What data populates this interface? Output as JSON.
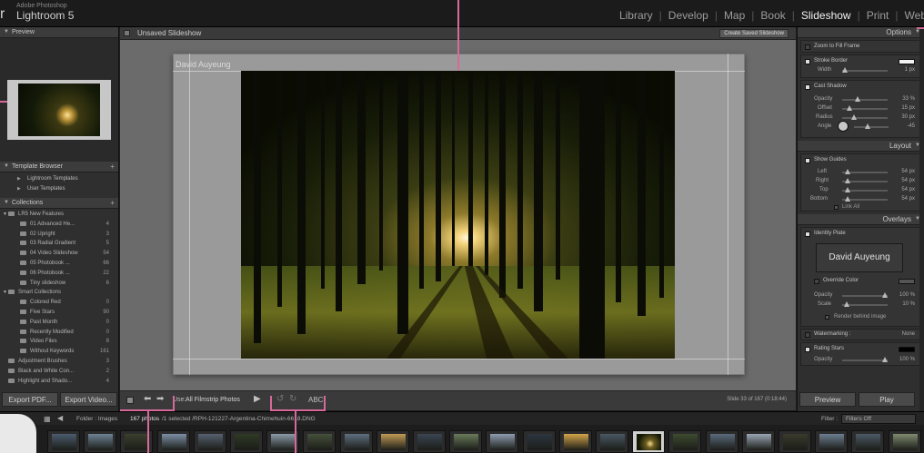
{
  "app": {
    "brand_small": "Adobe Photoshop",
    "brand": "Lightroom 5",
    "edge_letter": "r"
  },
  "modules": [
    {
      "label": "Library",
      "active": false
    },
    {
      "label": "Develop",
      "active": false
    },
    {
      "label": "Map",
      "active": false
    },
    {
      "label": "Book",
      "active": false
    },
    {
      "label": "Slideshow",
      "active": true
    },
    {
      "label": "Print",
      "active": false
    },
    {
      "label": "Web",
      "active": false
    }
  ],
  "left": {
    "preview_title": "Preview",
    "template_title": "Template Browser",
    "templates": [
      "Lightroom Templates",
      "User Templates"
    ],
    "collections_title": "Collections",
    "collections": [
      {
        "label": "LR5 New Features",
        "count": "",
        "indent": 1,
        "group": true
      },
      {
        "label": "01 Advanced He...",
        "count": "4",
        "indent": 2
      },
      {
        "label": "02 Upright",
        "count": "3",
        "indent": 2
      },
      {
        "label": "03 Radial Gradient",
        "count": "5",
        "indent": 2
      },
      {
        "label": "04 Video Slideshow",
        "count": "54",
        "indent": 2
      },
      {
        "label": "05 Photobook ...",
        "count": "66",
        "indent": 2
      },
      {
        "label": "06 Photobook ...",
        "count": "22",
        "indent": 2
      },
      {
        "label": "Tiny slideshow",
        "count": "6",
        "indent": 2
      },
      {
        "label": "Smart Collections",
        "count": "",
        "indent": 1,
        "group": true
      },
      {
        "label": "Colored Red",
        "count": "0",
        "indent": 2
      },
      {
        "label": "Five Stars",
        "count": "90",
        "indent": 2
      },
      {
        "label": "Past Month",
        "count": "0",
        "indent": 2
      },
      {
        "label": "Recently Modified",
        "count": "0",
        "indent": 2
      },
      {
        "label": "Video Files",
        "count": "8",
        "indent": 2
      },
      {
        "label": "Without Keywords",
        "count": "161",
        "indent": 2
      },
      {
        "label": "Adjustment Brushes",
        "count": "3",
        "indent": 1
      },
      {
        "label": "Black and White Con...",
        "count": "2",
        "indent": 1
      },
      {
        "label": "Highlight and Shado...",
        "count": "4",
        "indent": 1
      }
    ],
    "export_pdf": "Export PDF...",
    "export_video": "Export Video..."
  },
  "center": {
    "title": "Unsaved Slideshow",
    "create_saved": "Create Saved Slideshow",
    "identity": "David Auyeung",
    "use_label": "Use:",
    "use_value": "All Filmstrip Photos",
    "abc": "ABC",
    "slide_info": "Slide 33 of 167 (0:18:44)"
  },
  "right": {
    "options_title": "Options",
    "zoom_fill": "Zoom to Fill Frame",
    "stroke_border": "Stroke Border",
    "width_label": "Width",
    "width_val": "1 px",
    "cast_shadow": "Cast Shadow",
    "opacity_label": "Opacity",
    "opacity_val": "33 %",
    "offset_label": "Offset",
    "offset_val": "15 px",
    "radius_label": "Radius",
    "radius_val": "30 px",
    "angle_label": "Angle",
    "angle_val": "-45",
    "layout_title": "Layout",
    "show_guides": "Show Guides",
    "left_label": "Left",
    "left_val": "54 px",
    "right_label": "Right",
    "right_val": "54 px",
    "top_label": "Top",
    "top_val": "54 px",
    "bottom_label": "Bottom",
    "bottom_val": "54 px",
    "link_all": "Link All",
    "overlays_title": "Overlays",
    "identity_plate": "Identity Plate",
    "identity_plate_text": "David Auyeung",
    "override_color": "Override Color",
    "io_opacity_label": "Opacity",
    "io_opacity_val": "100 %",
    "scale_label": "Scale",
    "scale_val": "10 %",
    "render_behind": "Render behind image",
    "watermarking": "Watermarking :",
    "watermark_val": "None",
    "rating_stars": "Rating Stars",
    "rs_opacity_label": "Opacity",
    "rs_opacity_val": "100 %",
    "preview_btn": "Preview",
    "play_btn": "Play"
  },
  "filmstrip": {
    "folder": "Folder : Images",
    "photos": "167 photos",
    "selected": "/1 selected /RPH-121227-Argentina-Chimehuin-6618.DNG",
    "filter_label": "Filter :",
    "filter_val": "Filters Off"
  },
  "colors": {
    "accent_guide": "#d66a9a",
    "panel": "#2f2f2f",
    "header": "#3c3c3c"
  }
}
